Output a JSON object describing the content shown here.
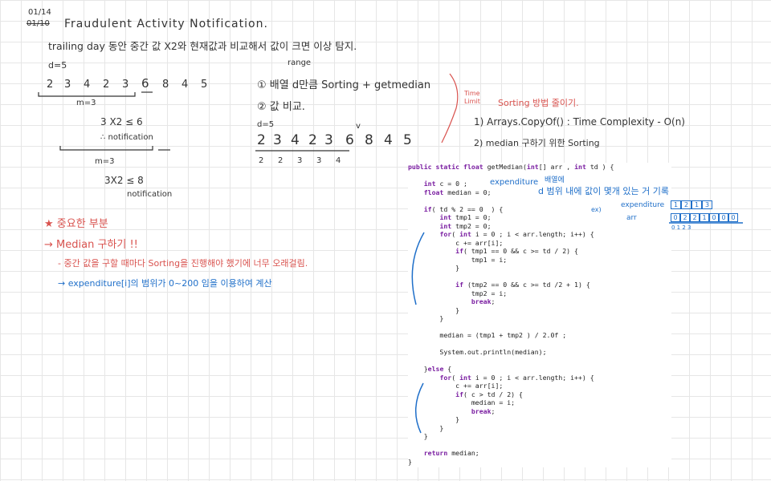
{
  "header": {
    "date": "01/14",
    "date_struck": "01/10",
    "title": "Fraudulent Activity Notification.",
    "subtitle": "trailing day 동안 중간 값 X2와 현재값과 비교해서 값이 크면 이상 탐지."
  },
  "left_notes": {
    "d_label": "d=5",
    "array1": [
      "2",
      "3",
      "4",
      "2",
      "3",
      "6",
      "8",
      "4",
      "5"
    ],
    "m1": "m=3",
    "calc1": "3 X2 ≤ 6",
    "calc1_note": "∴ notification",
    "m2": "m=3",
    "calc2": "3X2 ≤ 8",
    "calc2_note": "notification"
  },
  "middle_notes": {
    "range_label": "range",
    "step1": "① 배열 d만큼 Sorting + getmedian",
    "step2": "② 값 비교.",
    "d_label": "d=5",
    "check": "v",
    "array2": [
      "2",
      "3",
      "4",
      "2",
      "3",
      "6",
      "8",
      "4",
      "5"
    ],
    "sorted": [
      "2",
      "2",
      "3",
      "3",
      "4"
    ]
  },
  "right_notes": {
    "time_label": "Time Limit",
    "heading": "Sorting 방법 줄이기.",
    "item1": "1) Arrays.CopyOf() : Time Complexity - O(n)",
    "item2": "2) median 구하기 위한 Sorting"
  },
  "important": {
    "title": "★ 중요한 부분",
    "arrow1": "→ Median 구하기 !!",
    "dash1": "- 중간 값을 구할 때마다 Sorting을 진행해야 했기에 너무 오래걸림.",
    "arrow2": "→ expenditure[i]의 범위가 0~200 임을 이용하여 계산"
  },
  "annotations": {
    "expenditure": "expenditure",
    "array_label": "배열에",
    "d_range": "d 범위 내에 값이 몇개 있는 거 기록",
    "ex": "ex)",
    "exp_label": "expenditure",
    "exp_cells": [
      "1",
      "2",
      "1",
      "3"
    ],
    "arr_label": "arr",
    "arr_cells": [
      "0",
      "2",
      "2",
      "1",
      "0",
      "0",
      "0"
    ],
    "arr_index": "0 1 2 3"
  },
  "code": {
    "lines": [
      "public static float getMedian(int[] arr , int td ) {",
      "",
      "    int c = 0 ;",
      "    float median = 0;",
      "",
      "    if( td % 2 == 0  ) {",
      "        int tmp1 = 0;",
      "        int tmp2 = 0;",
      "        for( int i = 0 ; i < arr.length; i++) {",
      "            c += arr[i];",
      "            if( tmp1 == 0 && c >= td / 2) {",
      "                tmp1 = i;",
      "            }",
      "",
      "            if (tmp2 == 0 && c >= td /2 + 1) {",
      "                tmp2 = i;",
      "                break;",
      "            }",
      "        }",
      "",
      "        median = (tmp1 + tmp2 ) / 2.0f ;",
      "",
      "        System.out.println(median);",
      "",
      "    }else {",
      "        for( int i = 0 ; i < arr.length; i++) {",
      "            c += arr[i];",
      "            if( c > td / 2) {",
      "                median = i;",
      "                break;",
      "            }",
      "        }",
      "    }",
      "",
      "    return median;",
      "}"
    ]
  }
}
